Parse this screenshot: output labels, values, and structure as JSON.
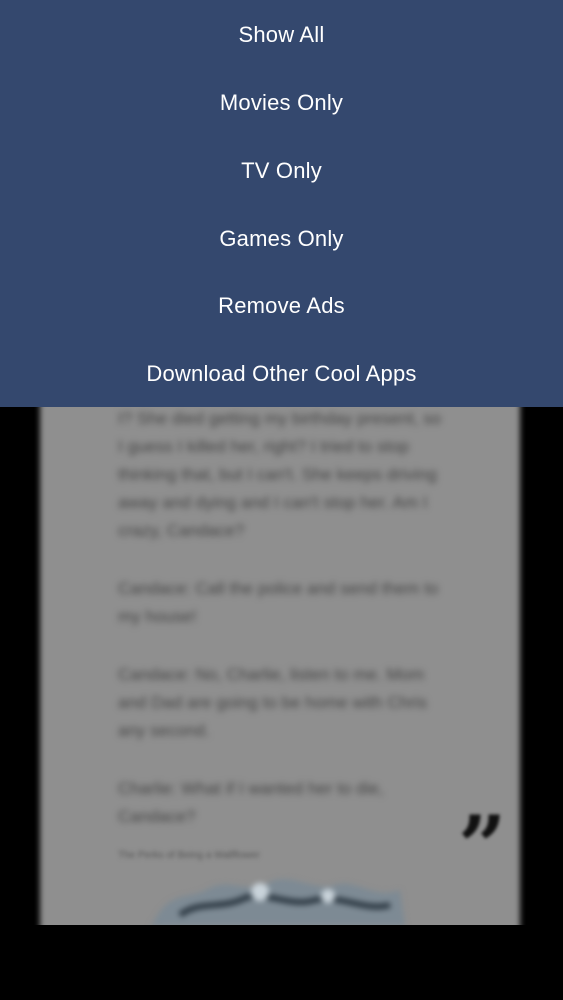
{
  "menu": {
    "items": [
      {
        "label": "Show All"
      },
      {
        "label": "Movies Only"
      },
      {
        "label": "TV Only"
      },
      {
        "label": "Games Only"
      },
      {
        "label": "Remove Ads"
      },
      {
        "label": "Download Other Cool Apps"
      }
    ]
  },
  "card": {
    "paragraphs": [
      "I? She died getting my birthday present, so I guess I killed her, right? I tried to stop thinking that, but I can't. She keeps driving away and dying and I can't stop her. Am I crazy, Candace?",
      "Candace: Call the police and send them to my house!",
      "Candace: No, Charlie, listen to me. Mom and Dad are going to be home with Chris any second.",
      "Charlie: What if I wanted her to die, Candace?"
    ],
    "caption": "The Perks of Being a Wallflower",
    "quote_glyph": "”"
  },
  "colors": {
    "menu_bg": "#34486e",
    "menu_text": "#ffffff",
    "backdrop": "#000000",
    "card_bg": "#8f8f8f"
  }
}
